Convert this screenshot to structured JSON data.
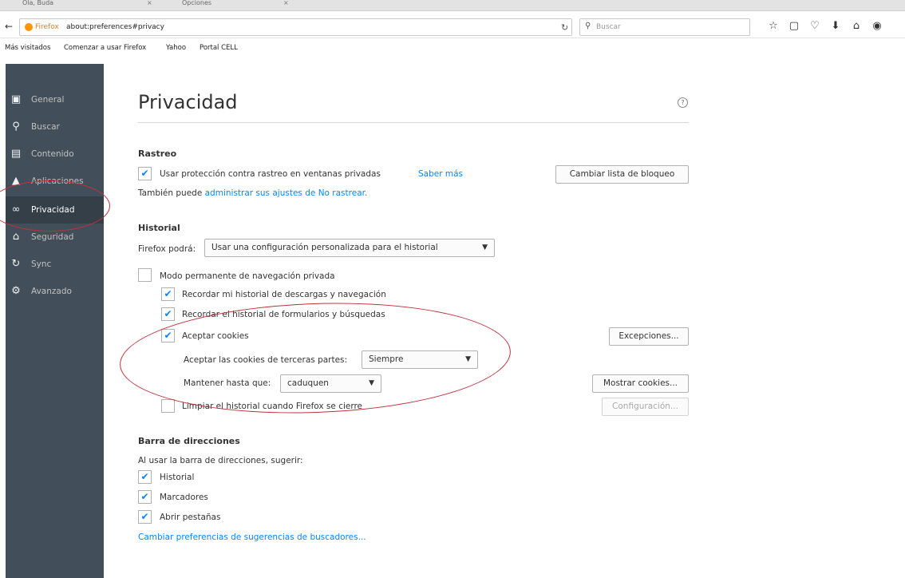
{
  "browser": {
    "tabs": [
      {
        "label": "Ola, Buda",
        "close": "×"
      },
      {
        "label": "Opciones",
        "close": "×"
      }
    ],
    "back_glyph": "←",
    "identity_label": "Firefox",
    "url": "about:preferences#privacy",
    "reload_glyph": "↻",
    "search_placeholder": "Buscar",
    "search_glyph": "⚲",
    "toolbar_icons": [
      {
        "name": "bookmark-star-icon",
        "glyph": "☆"
      },
      {
        "name": "library-icon",
        "glyph": "▢"
      },
      {
        "name": "pocket-icon",
        "glyph": "♡"
      },
      {
        "name": "downloads-icon",
        "glyph": "⬇"
      },
      {
        "name": "home-icon",
        "glyph": "⌂"
      },
      {
        "name": "chat-icon",
        "glyph": "◉"
      }
    ]
  },
  "bookmarks": [
    "Más visitados",
    "Comenzar a usar Firefox",
    "Yahoo",
    "Portal CELL"
  ],
  "sidebar": {
    "items": [
      {
        "label": "General",
        "glyph": "▣"
      },
      {
        "label": "Buscar",
        "glyph": "⚲"
      },
      {
        "label": "Contenido",
        "glyph": "▤"
      },
      {
        "label": "Aplicaciones",
        "glyph": "▲"
      },
      {
        "label": "Privacidad",
        "glyph": "∞"
      },
      {
        "label": "Seguridad",
        "glyph": "⌂"
      },
      {
        "label": "Sync",
        "glyph": "↻"
      },
      {
        "label": "Avanzado",
        "glyph": "⚙"
      }
    ]
  },
  "page": {
    "title": "Privacidad",
    "help_glyph": "?",
    "check_glyph": "✔"
  },
  "tracking": {
    "heading": "Rastreo",
    "use_protection_label": "Usar protección contra rastreo en ventanas privadas",
    "learn_more": "Saber más",
    "change_blocklist_button": "Cambiar lista de bloqueo",
    "also_prefix": "También puede ",
    "manage_dnt_link": "administrar sus ajustes de No rastrear."
  },
  "history": {
    "heading": "Historial",
    "firefox_will_label": "Firefox podrá:",
    "firefox_will_value": "Usar una configuración personalizada para el historial",
    "permanent_private_label": "Modo permanente de navegación privada",
    "remember_downloads_label": "Recordar mi historial de descargas y navegación",
    "remember_forms_label": "Recordar el historial de formularios y búsquedas",
    "accept_cookies_label": "Aceptar cookies",
    "exceptions_button": "Excepciones...",
    "third_party_label": "Aceptar las cookies de terceras partes:",
    "third_party_value": "Siempre",
    "keep_until_label": "Mantener hasta que:",
    "keep_until_value": "caduquen",
    "show_cookies_button": "Mostrar cookies...",
    "clear_on_close_label": "Limpiar el historial cuando Firefox se cierre",
    "settings_button": "Configuración..."
  },
  "location_bar": {
    "heading": "Barra de direcciones",
    "suggest_label": "Al usar la barra de direcciones, sugerir:",
    "history_label": "Historial",
    "bookmarks_label": "Marcadores",
    "open_tabs_label": "Abrir pestañas",
    "change_search_link": "Cambiar preferencias de sugerencias de buscadores..."
  },
  "colors": {
    "sidebar_bg": "#424f5a",
    "sidebar_active_bg": "#343f48",
    "link": "#0a84ff",
    "annotation_red": "#c0303a"
  }
}
